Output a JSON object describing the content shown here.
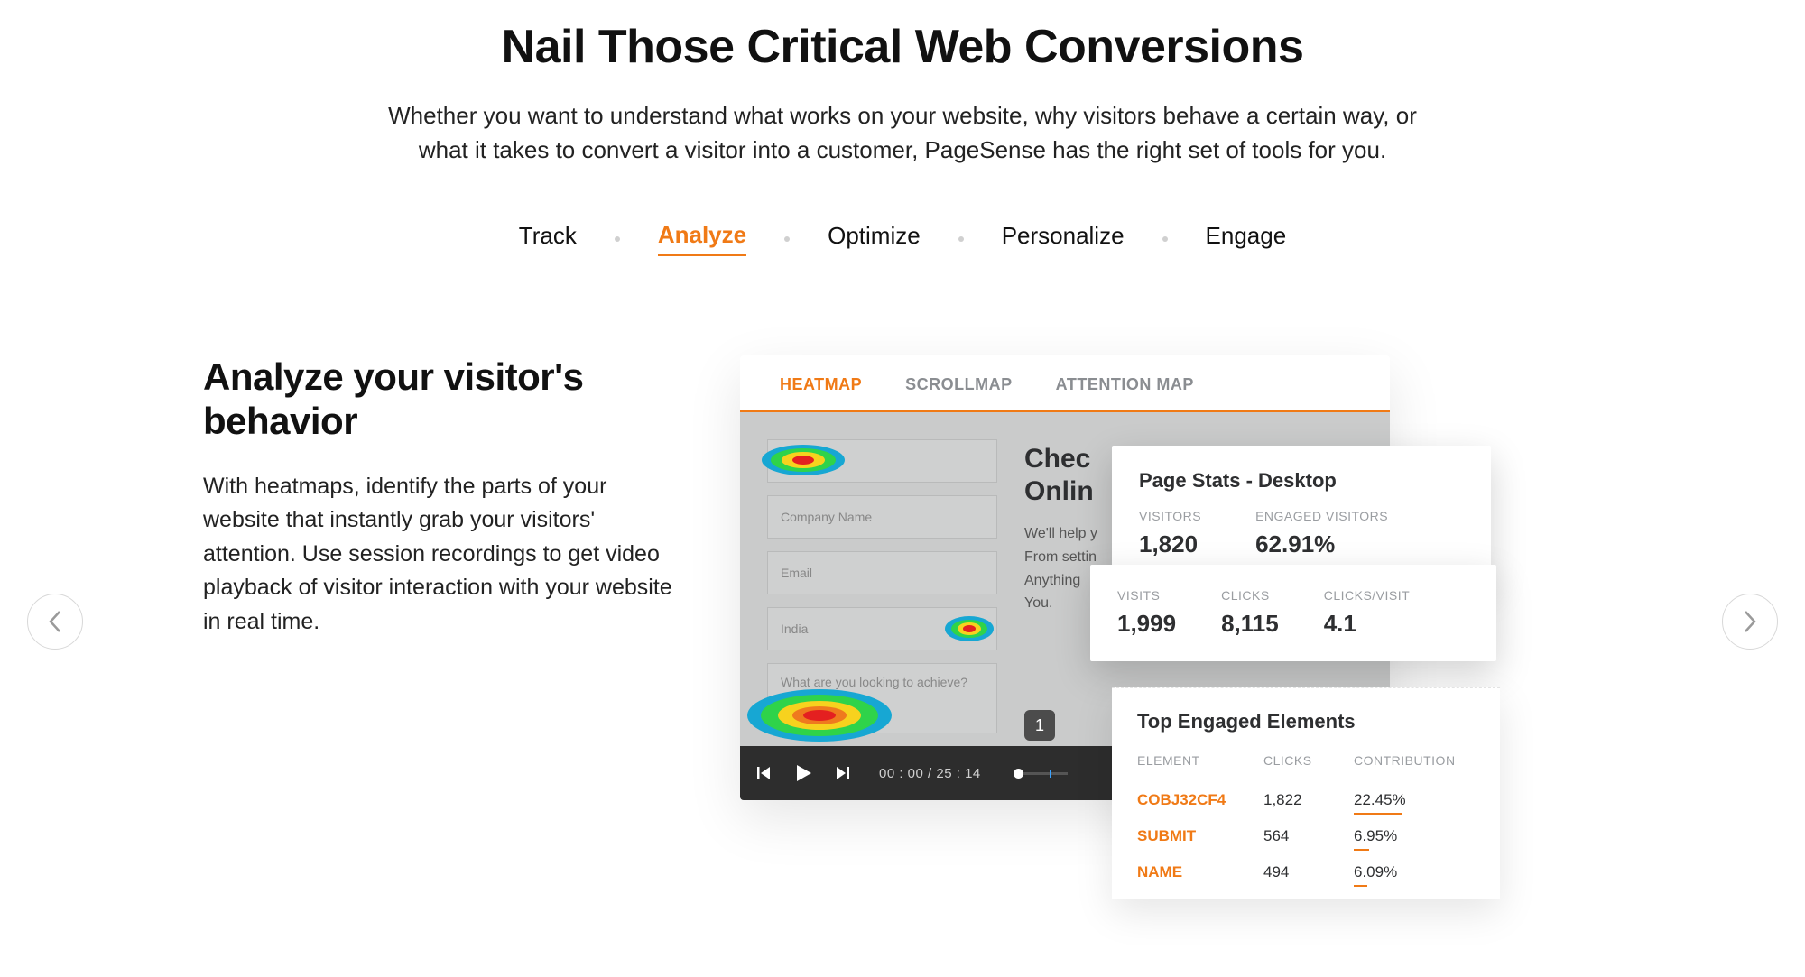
{
  "hero": {
    "title": "Nail Those Critical Web Conversions",
    "subtitle": "Whether you want to understand what works on your website, why visitors behave a certain way, or what it takes to convert a visitor into a customer, PageSense has the right set of tools for you."
  },
  "tabs": {
    "items": [
      "Track",
      "Analyze",
      "Optimize",
      "Personalize",
      "Engage"
    ],
    "active_index": 1
  },
  "copy": {
    "title": "Analyze your visitor's behavior",
    "body": "With heatmaps, identify the parts of your website that instantly grab your visitors' attention. Use session recordings to get video playback of visitor interaction with your website in real time."
  },
  "screenshot": {
    "tabs": [
      "HEATMAP",
      "SCROLLMAP",
      "ATTENTION MAP"
    ],
    "active_tab": 0,
    "form": {
      "fields": [
        "",
        "Company Name",
        "Email",
        "India",
        "What are you looking to achieve?"
      ],
      "dropdown_index": 3
    },
    "right_title_line1": "Chec",
    "right_title_line2": "Onlin",
    "right_text": [
      "We'll help y",
      "From settin",
      "Anything",
      "You."
    ],
    "player": {
      "current": "00 : 00",
      "total": "25 : 14",
      "tooltip": "1"
    }
  },
  "stats": {
    "card1": {
      "title": "Page Stats - Desktop",
      "row": [
        {
          "label": "VISITORS",
          "value": "1,820"
        },
        {
          "label": "ENGAGED VISITORS",
          "value": "62.91%"
        }
      ]
    },
    "card2": {
      "row": [
        {
          "label": "VISITS",
          "value": "1,999"
        },
        {
          "label": "CLICKS",
          "value": "8,115"
        },
        {
          "label": "CLICKS/VISIT",
          "value": "4.1"
        }
      ]
    },
    "engaged": {
      "title": "Top Engaged Elements",
      "headers": [
        "ELEMENT",
        "CLICKS",
        "CONTRIBUTION"
      ],
      "rows": [
        {
          "element": "COBJ32CF4",
          "clicks": "1,822",
          "contribution": "22.45%",
          "bar": 0.6
        },
        {
          "element": "SUBMIT",
          "clicks": "564",
          "contribution": "6.95%",
          "bar": 0.19
        },
        {
          "element": "NAME",
          "clicks": "494",
          "contribution": "6.09%",
          "bar": 0.17
        }
      ]
    }
  }
}
